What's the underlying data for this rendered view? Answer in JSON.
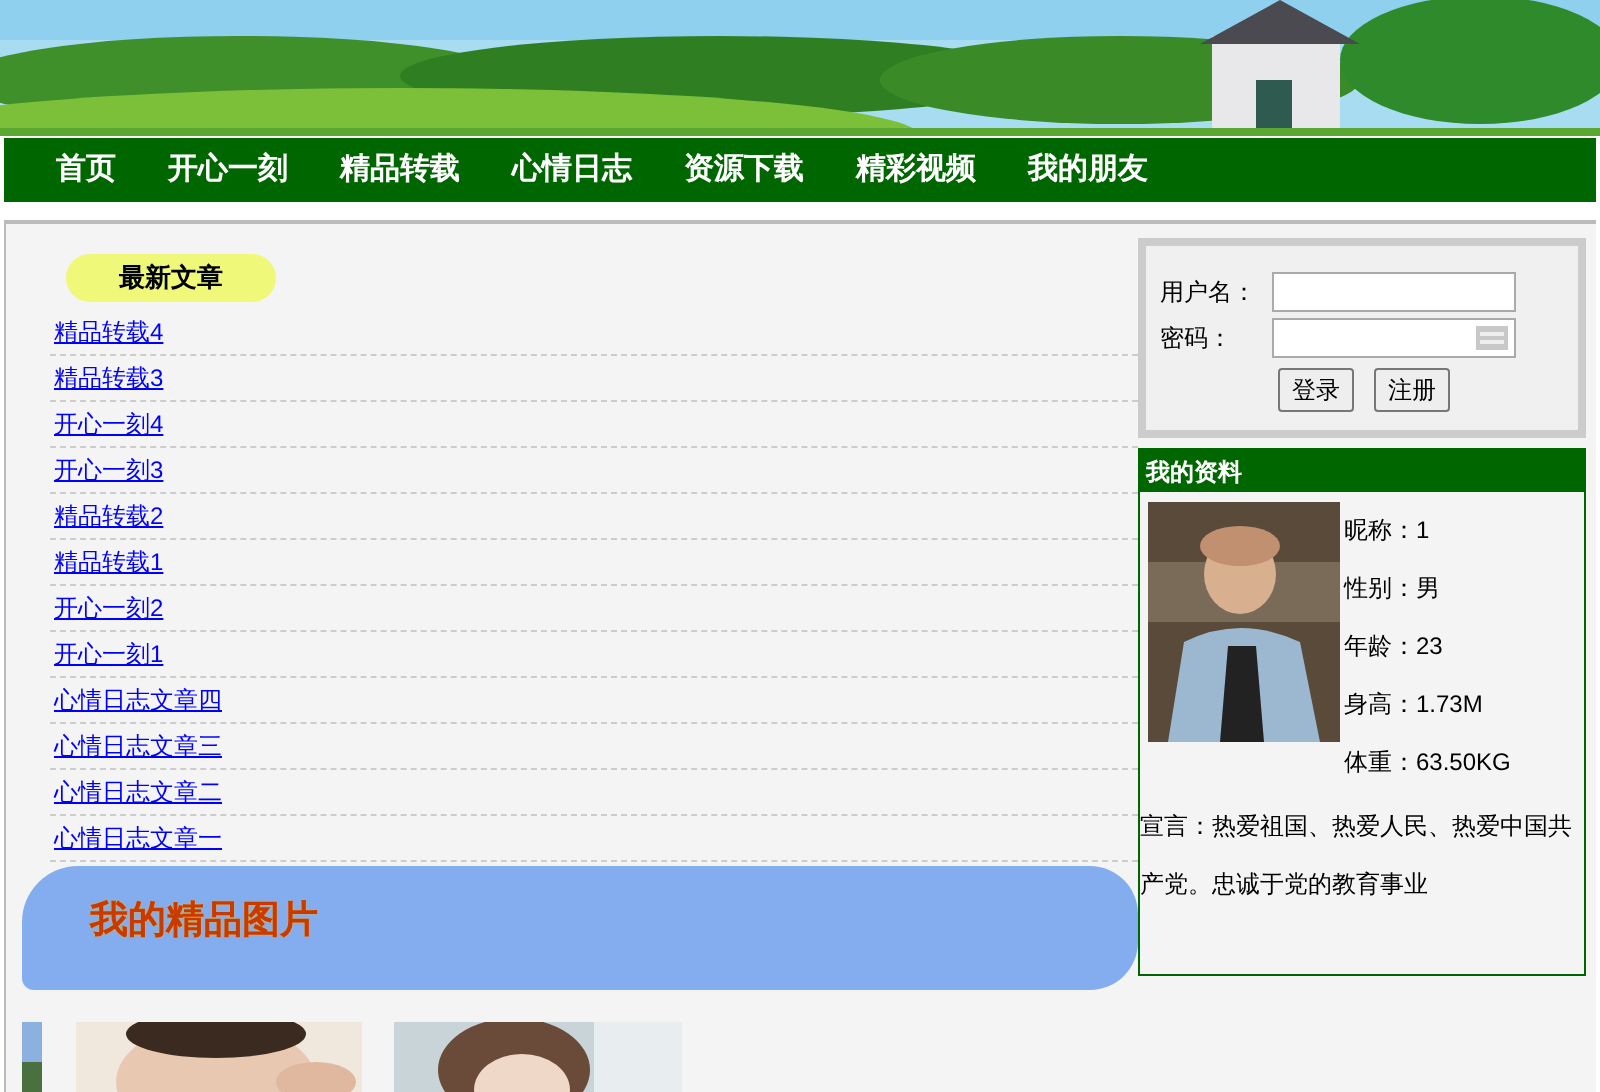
{
  "nav": [
    {
      "label": "首页"
    },
    {
      "label": "开心一刻"
    },
    {
      "label": "精品转载"
    },
    {
      "label": "心情日志"
    },
    {
      "label": "资源下载"
    },
    {
      "label": "精彩视频"
    },
    {
      "label": "我的朋友"
    }
  ],
  "articles": {
    "title": "最新文章",
    "items": [
      "精品转载4",
      "精品转载3",
      "开心一刻4",
      "开心一刻3",
      "精品转载2",
      "精品转载1",
      "开心一刻2",
      "开心一刻1",
      "心情日志文章四",
      "心情日志文章三",
      "心情日志文章二",
      "心情日志文章一"
    ]
  },
  "gallery": {
    "title": "我的精品图片"
  },
  "login": {
    "username_label": "用户名：",
    "password_label": "密码：",
    "buttons": [
      "登录",
      "注册"
    ]
  },
  "profile": {
    "title": "我的资料",
    "fields": [
      "昵称：1",
      "性别：男",
      "年龄：23",
      "身高：1.73M",
      "体重：63.50KG"
    ],
    "motto": "宣言：热爱祖国、热爱人民、热爱中国共产党。忠诚于党的教育事业"
  }
}
